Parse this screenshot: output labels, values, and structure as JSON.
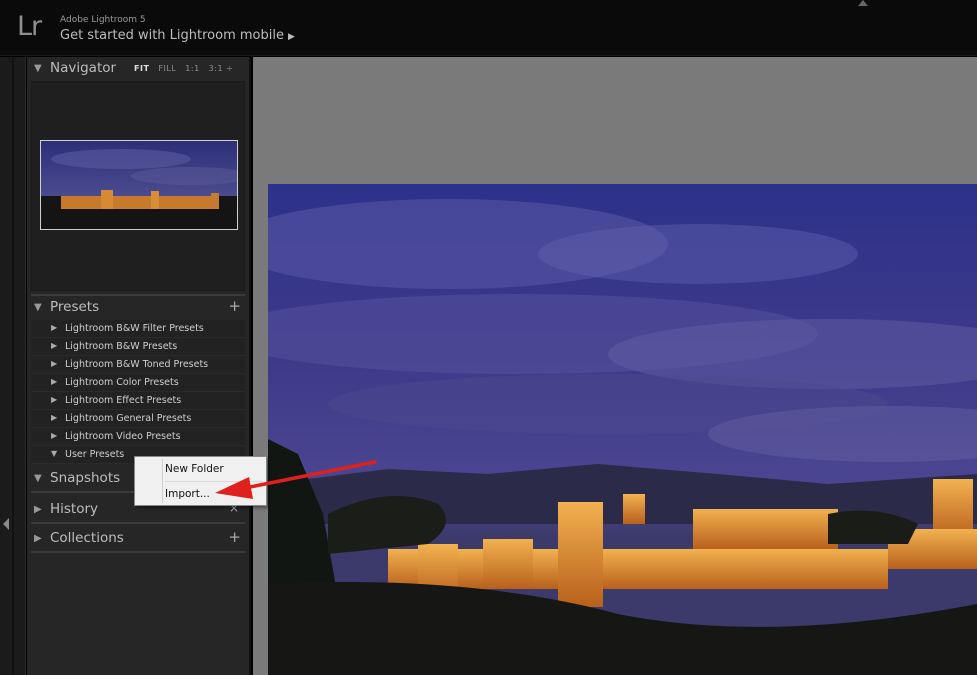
{
  "app": {
    "logo": "Lr",
    "name": "Adobe Lightroom 5",
    "mobile_link": "Get started with Lightroom mobile",
    "mobile_arrow": "▶"
  },
  "navigator": {
    "title": "Navigator",
    "options": [
      "FIT",
      "FILL",
      "1:1",
      "3:1 ÷"
    ]
  },
  "presets": {
    "title": "Presets",
    "add_icon": "+",
    "items": [
      {
        "label": "Lightroom B&W Filter Presets",
        "expanded": false
      },
      {
        "label": "Lightroom B&W Presets",
        "expanded": false
      },
      {
        "label": "Lightroom B&W Toned Presets",
        "expanded": false
      },
      {
        "label": "Lightroom Color Presets",
        "expanded": false
      },
      {
        "label": "Lightroom Effect Presets",
        "expanded": false
      },
      {
        "label": "Lightroom General Presets",
        "expanded": false
      },
      {
        "label": "Lightroom Video Presets",
        "expanded": false
      },
      {
        "label": "User Presets",
        "expanded": true
      }
    ]
  },
  "snapshots": {
    "title": "Snapshots"
  },
  "history": {
    "title": "History",
    "clear_icon": "×"
  },
  "collections": {
    "title": "Collections",
    "add_icon": "+"
  },
  "context_menu": {
    "items": [
      "New Folder",
      "Import..."
    ]
  },
  "glyphs": {
    "collapsed": "▶",
    "expanded": "▼"
  },
  "colors": {
    "annotation_arrow": "#e0201c",
    "panel_bg": "#262626",
    "workspace_bg": "#7a7a7a"
  }
}
